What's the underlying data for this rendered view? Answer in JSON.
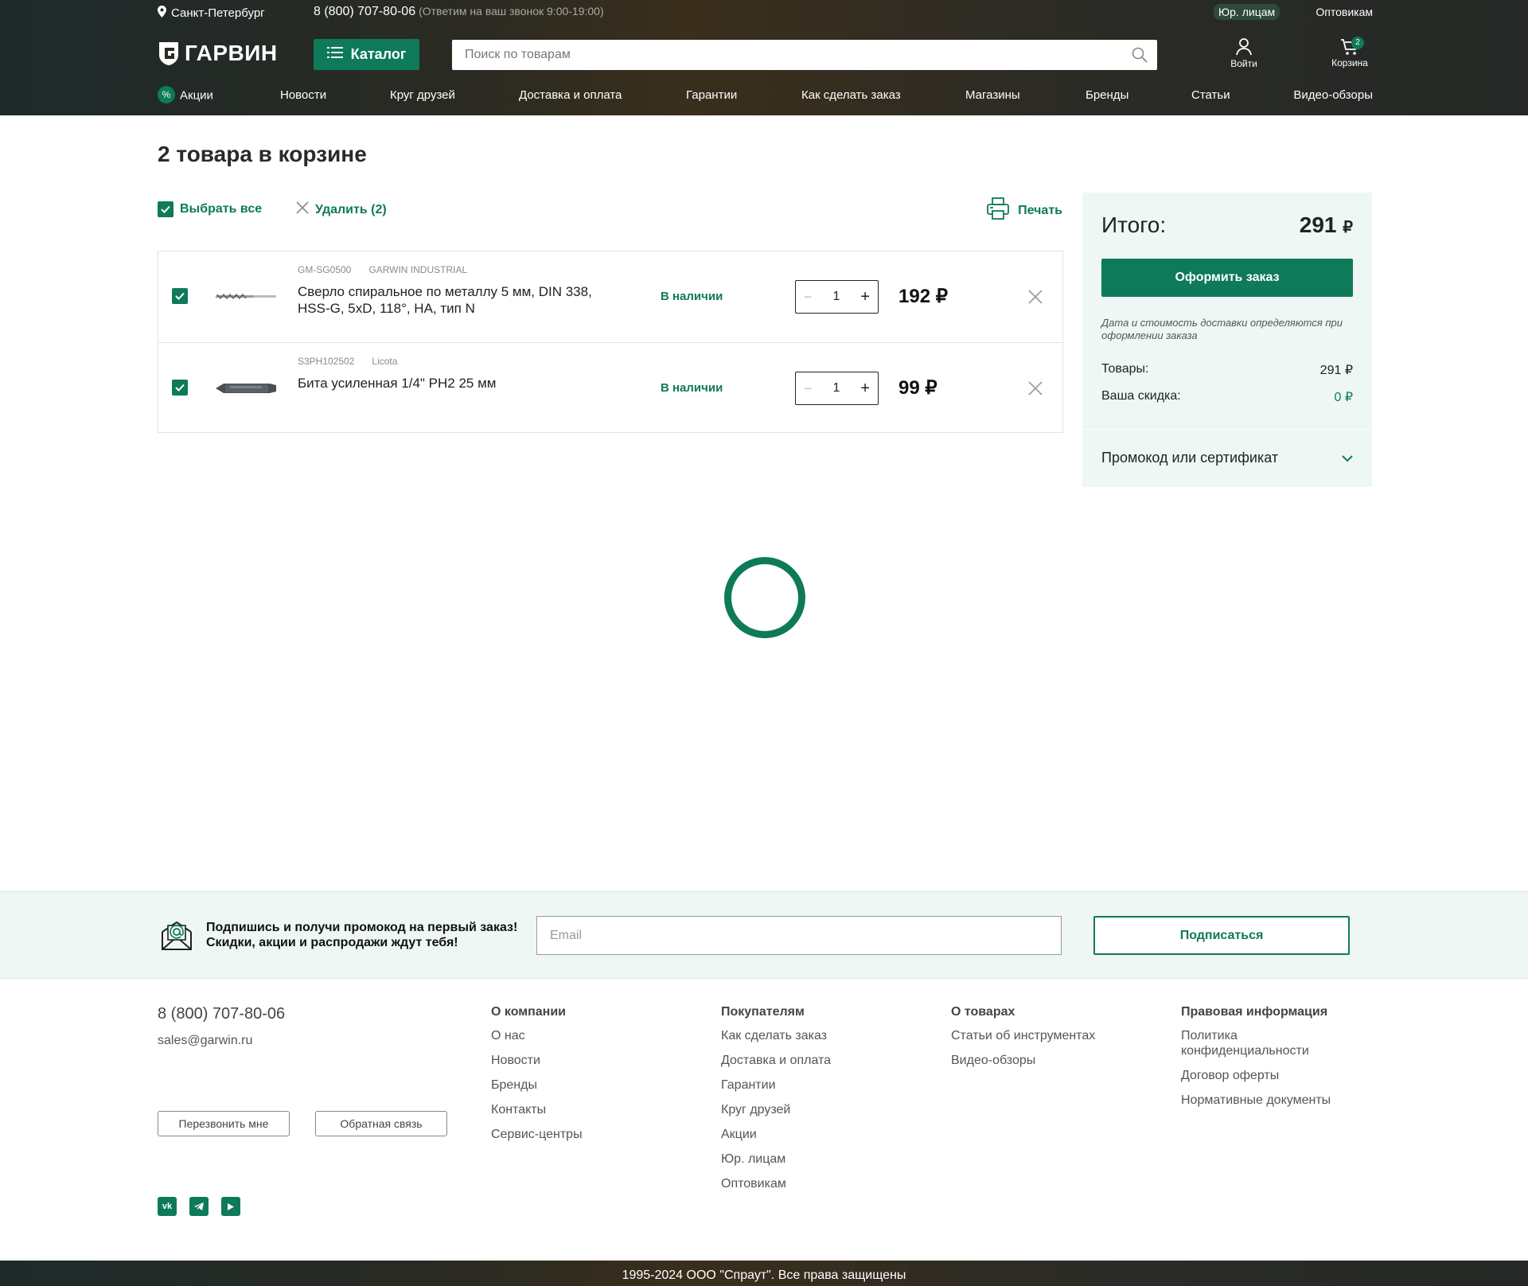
{
  "header": {
    "city": "Санкт-Петербург",
    "phone": "8 (800) 707-80-06",
    "phone_note": "(Ответим на ваш звонок 9:00-19:00)",
    "corporate_link": "Юр. лицам",
    "wholesale_link": "Оптовикам",
    "logo_text": "ГАРВИН",
    "catalog_label": "Каталог",
    "search_placeholder": "Поиск по товарам",
    "login_label": "Войти",
    "cart_label": "Корзина",
    "cart_count": "2",
    "nav": [
      "Акции",
      "Новости",
      "Круг друзей",
      "Доставка и оплата",
      "Гарантии",
      "Как сделать заказ",
      "Магазины",
      "Бренды",
      "Статьи",
      "Видео-обзоры"
    ]
  },
  "cart": {
    "title": "2 товара в корзине",
    "select_all": "Выбрать все",
    "delete_selected": "Удалить (2)",
    "print": "Печать",
    "items": [
      {
        "sku": "GM-SG0500",
        "brand": "GARWIN INDUSTRIAL",
        "name": "Сверло спиральное по металлу 5 мм, DIN 338, HSS-G, 5xD, 118°, HA, тип N",
        "stock": "В наличии",
        "qty": "1",
        "price": "192 ₽",
        "checked": true
      },
      {
        "sku": "S3PH102502",
        "brand": "Licota",
        "name": "Бита усиленная 1/4\" PH2 25 мм",
        "stock": "В наличии",
        "qty": "1",
        "price": "99 ₽",
        "checked": true
      }
    ]
  },
  "summary": {
    "total_label": "Итого:",
    "total_value": "291",
    "currency": "₽",
    "checkout_label": "Оформить заказ",
    "note": "Дата и стоимость доставки определяются при оформлении заказа",
    "goods_label": "Товары:",
    "goods_value": "291 ₽",
    "discount_label": "Ваша скидка:",
    "discount_value": "0 ₽",
    "promo_label": "Промокод или сертификат"
  },
  "subscribe": {
    "line1": "Подпишись и получи промокод на первый заказ!",
    "line2": "Скидки, акции и распродажи ждут тебя!",
    "email_placeholder": "Email",
    "button": "Подписаться"
  },
  "footer": {
    "phone": "8 (800) 707-80-06",
    "email": "sales@garwin.ru",
    "callback_button": "Перезвонить мне",
    "feedback_button": "Обратная связь",
    "columns": [
      {
        "title": "О компании",
        "items": [
          "О нас",
          "Новости",
          "Бренды",
          "Контакты",
          "Сервис-центры"
        ]
      },
      {
        "title": "Покупателям",
        "items": [
          "Как сделать заказ",
          "Доставка и оплата",
          "Гарантии",
          "Круг друзей",
          "Акции",
          "Юр. лицам",
          "Оптовикам"
        ]
      },
      {
        "title": "О товарах",
        "items": [
          "Статьи об инструментах",
          "Видео-обзоры"
        ]
      },
      {
        "title": "Правовая информация",
        "items": [
          "Политика конфиденциальности",
          "Договор оферты",
          "Нормативные документы"
        ]
      }
    ],
    "socials": [
      "vk-icon",
      "telegram-icon",
      "youtube-icon"
    ],
    "copyright": "1995-2024 ООО \"Спраут\". Все права защищены"
  },
  "colors": {
    "accent": "#0e7a5a",
    "summary_bg": "#eef7f4",
    "header_bg": "#2a2a22"
  }
}
